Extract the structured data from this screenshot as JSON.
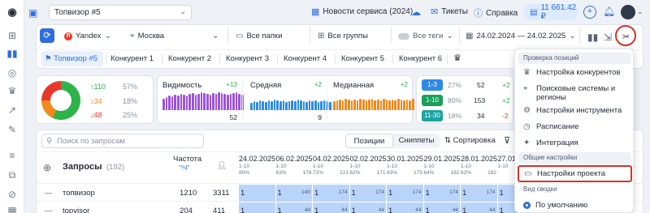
{
  "topbar": {
    "project_name": "Топвизор #5",
    "links": [
      {
        "label": "Новости сервиса (2024)",
        "icon": "calendar-icon"
      },
      {
        "label": "Тикеты",
        "icon": "mail-icon"
      },
      {
        "label": "Справка",
        "icon": "question-icon"
      }
    ],
    "balance": "11 661.42 ₽"
  },
  "filters": {
    "search_engine": "Yandex",
    "region": "Москва",
    "folders": "Все папки",
    "groups": "Все группы",
    "tags": "Все теги",
    "date_range": "24.02.2024 — 24.02.2025"
  },
  "competitor_tabs": [
    "Топвизор #5",
    "Конкурент 1",
    "Конкурент 2",
    "Конкурент 3",
    "Конкурент 4",
    "Конкурент 5",
    "Конкурент 6"
  ],
  "summary": {
    "donut_legend": [
      {
        "value": "↑110",
        "pct": "57%",
        "color": "#2db34a"
      },
      {
        "value": "↕34",
        "pct": "18%",
        "color": "#f08a1d"
      },
      {
        "value": "↓48",
        "pct": "25%",
        "color": "#e8382c"
      }
    ],
    "metrics": [
      {
        "title": "Видимость",
        "delta": "+13",
        "value": "52",
        "color": "#9b52e0"
      },
      {
        "title": "Средняя",
        "delta": "+2",
        "value": "9",
        "color": "#2d8be8"
      },
      {
        "title": "Медианная",
        "delta": "+2",
        "value": "",
        "color": "#f08a1d"
      }
    ],
    "ranks": [
      {
        "label": "1-3",
        "pct": "27%",
        "count": "52",
        "delta": "+2",
        "color": "#2d8be8"
      },
      {
        "label": "1-10",
        "pct": "80%",
        "count": "153",
        "delta": "+2",
        "color": "#1aa05a"
      },
      {
        "label": "11-30",
        "pct": "18%",
        "count": "34",
        "delta": "-2",
        "color": "#1ca3a3"
      }
    ]
  },
  "table": {
    "search_placeholder": "Поиск по запросам",
    "view_tabs": [
      "Позиции",
      "Сниппеты"
    ],
    "sort_label": "Сортировка",
    "col_queries": "Запросы",
    "queries_count": "(192)",
    "col_freq": "Частота",
    "freq_sub": "\"!Ч\"",
    "dates": [
      {
        "date": "24.02.2025",
        "range": "1-10",
        "pct": "80%",
        "n": ""
      },
      {
        "date": "06.02.2025",
        "range": "1-10",
        "pct": "63%",
        "n": "178"
      },
      {
        "date": "04.02.2025",
        "range": "1-10",
        "pct": "72%",
        "n": "221"
      },
      {
        "date": "02.02.2025",
        "range": "1-10",
        "pct": "62%",
        "n": "171"
      },
      {
        "date": "30.01.2025",
        "range": "1-10",
        "pct": "63%",
        "n": "175"
      },
      {
        "date": "29.01.2025",
        "range": "1-10",
        "pct": "64%",
        "n": "182"
      },
      {
        "date": "28.01.2025",
        "range": "1-10",
        "pct": "62%",
        "n": "182"
      },
      {
        "date": "27.01.2025",
        "range": "1-10",
        "pct": "",
        "n": ""
      }
    ],
    "rows": [
      {
        "query": "топвизор",
        "freq": "1210",
        "vol": "3311",
        "cells": [
          {
            "v": "1",
            "n": ""
          },
          {
            "v": "1",
            "n": "140"
          },
          {
            "v": "1",
            "n": "174"
          },
          {
            "v": "1",
            "n": "174"
          },
          {
            "v": "1",
            "n": "174"
          },
          {
            "v": "1",
            "n": "174"
          },
          {
            "v": "1",
            "n": "174"
          },
          {
            "v": "1",
            "n": ""
          }
        ]
      },
      {
        "query": "topvisor",
        "freq": "204",
        "vol": "411",
        "cells": [
          {
            "v": "1",
            "n": ""
          },
          {
            "v": "1",
            "n": "44"
          },
          {
            "v": "1",
            "n": "44"
          },
          {
            "v": "1",
            "n": "44"
          },
          {
            "v": "1",
            "n": "44"
          },
          {
            "v": "1",
            "n": "44"
          },
          {
            "v": "1",
            "n": "44"
          },
          {
            "v": "1",
            "n": ""
          }
        ]
      }
    ]
  },
  "menu": {
    "section1": "Проверка позиций",
    "items1": [
      {
        "label": "Настройка конкурентов",
        "icon": "trophy-icon"
      },
      {
        "label": "Поисковые системы и регионы",
        "icon": "pin-icon"
      },
      {
        "label": "Настройки инструмента",
        "icon": "gear-icon"
      },
      {
        "label": "Расписание",
        "icon": "clock-icon"
      },
      {
        "label": "Интеграция",
        "icon": "sparkle-icon"
      }
    ],
    "section2": "Общие настройки",
    "project_settings": "Настройки проекта",
    "section3": "Вид сводки",
    "default_view": "По умолчанию"
  }
}
